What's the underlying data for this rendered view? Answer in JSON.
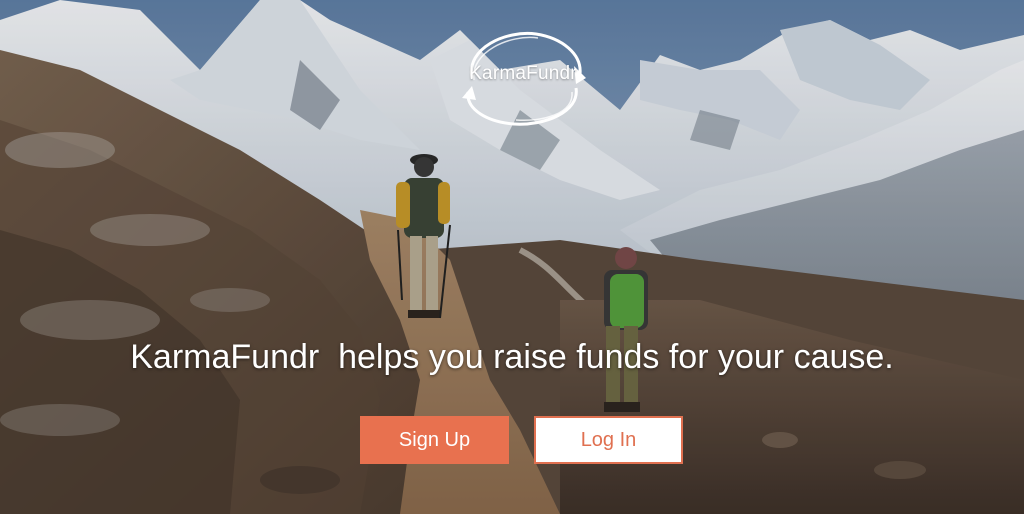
{
  "brand": {
    "name": "KarmaFundr"
  },
  "hero": {
    "tagline": "KarmaFundr  helps you raise funds for your cause."
  },
  "actions": {
    "signup_label": "Sign Up",
    "login_label": "Log In"
  },
  "colors": {
    "accent": "#e8714f",
    "login_text": "#e07050",
    "tagline_text": "#ffffff"
  },
  "icons": {
    "logo": "circular-arrows-logo-icon"
  }
}
